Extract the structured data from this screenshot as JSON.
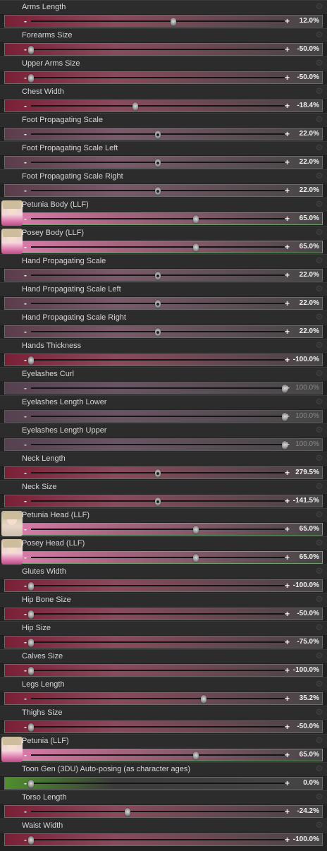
{
  "gear_icon": "gear-icon",
  "rows": [
    {
      "label": "Arms Length",
      "value": "12.0%",
      "pos": 0.56,
      "gradient": [
        "#7a1f36",
        "#8a4b5c"
      ],
      "muted": false,
      "thumb": false,
      "center": false
    },
    {
      "label": "Forearms Size",
      "value": "-50.0%",
      "pos": 0.0,
      "gradient": [
        "#7a1f36",
        "#8a4b5c"
      ],
      "muted": false,
      "thumb": false,
      "center": false
    },
    {
      "label": "Upper Arms Size",
      "value": "-50.0%",
      "pos": 0.0,
      "gradient": [
        "#7a1f36",
        "#8a4b5c"
      ],
      "muted": false,
      "thumb": false,
      "center": false
    },
    {
      "label": "Chest Width",
      "value": "-18.4%",
      "pos": 0.41,
      "gradient": [
        "#7a1f36",
        "#8a4b5c"
      ],
      "muted": false,
      "thumb": false,
      "center": false
    },
    {
      "label": "Foot Propagating Scale",
      "value": "22.0%",
      "pos": 0.5,
      "gradient": [
        "#5a3c4a",
        "#7a5a6a"
      ],
      "muted": false,
      "thumb": false,
      "center": true
    },
    {
      "label": "Foot Propagating Scale Left",
      "value": "22.0%",
      "pos": 0.5,
      "gradient": [
        "#5a3c4a",
        "#7a5a6a"
      ],
      "muted": false,
      "thumb": false,
      "center": true
    },
    {
      "label": "Foot Propagating Scale Right",
      "value": "22.0%",
      "pos": 0.5,
      "gradient": [
        "#5a3c4a",
        "#7a5a6a"
      ],
      "muted": false,
      "thumb": false,
      "center": true
    },
    {
      "label": "Petunia Body (LLF)",
      "value": "65.0%",
      "pos": 0.65,
      "gradient": [
        "#e07fb0",
        "#a6657f"
      ],
      "muted": false,
      "thumb": true,
      "center": false,
      "kind": "body"
    },
    {
      "label": "Posey Body (LLF)",
      "value": "65.0%",
      "pos": 0.65,
      "gradient": [
        "#e07fb0",
        "#a6657f"
      ],
      "muted": false,
      "thumb": true,
      "center": false,
      "kind": "body"
    },
    {
      "label": "Hand Propagating Scale",
      "value": "22.0%",
      "pos": 0.5,
      "gradient": [
        "#5a3c4a",
        "#7a5a6a"
      ],
      "muted": false,
      "thumb": false,
      "center": true
    },
    {
      "label": "Hand Propagating Scale Left",
      "value": "22.0%",
      "pos": 0.5,
      "gradient": [
        "#5a3c4a",
        "#7a5a6a"
      ],
      "muted": false,
      "thumb": false,
      "center": true
    },
    {
      "label": "Hand Propagating Scale Right",
      "value": "22.0%",
      "pos": 0.5,
      "gradient": [
        "#5a3c4a",
        "#7a5a6a"
      ],
      "muted": false,
      "thumb": false,
      "center": true
    },
    {
      "label": "Hands Thickness",
      "value": "-100.0%",
      "pos": 0.0,
      "gradient": [
        "#7a1f36",
        "#8a4b5c"
      ],
      "muted": false,
      "thumb": false,
      "center": false
    },
    {
      "label": "Eyelashes Curl",
      "value": "100.0%",
      "pos": 1.0,
      "gradient": [
        "#54404f",
        "#6b5565"
      ],
      "muted": true,
      "thumb": false,
      "center": false
    },
    {
      "label": "Eyelashes Length Lower",
      "value": "100.0%",
      "pos": 1.0,
      "gradient": [
        "#54404f",
        "#6b5565"
      ],
      "muted": true,
      "thumb": false,
      "center": false
    },
    {
      "label": "Eyelashes Length Upper",
      "value": "100.0%",
      "pos": 1.0,
      "gradient": [
        "#54404f",
        "#6b5565"
      ],
      "muted": true,
      "thumb": false,
      "center": false
    },
    {
      "label": "Neck Length",
      "value": "279.5%",
      "pos": 0.5,
      "gradient": [
        "#7a1f36",
        "#8a4b5c"
      ],
      "muted": false,
      "thumb": false,
      "center": true
    },
    {
      "label": "Neck Size",
      "value": "-141.5%",
      "pos": 0.5,
      "gradient": [
        "#7a1f36",
        "#8a4b5c"
      ],
      "muted": false,
      "thumb": false,
      "center": true
    },
    {
      "label": "Petunia Head (LLF)",
      "value": "65.0%",
      "pos": 0.65,
      "gradient": [
        "#e07fb0",
        "#a6657f"
      ],
      "muted": false,
      "thumb": true,
      "center": false,
      "kind": "head"
    },
    {
      "label": "Posey Head (LLF)",
      "value": "65.0%",
      "pos": 0.65,
      "gradient": [
        "#e07fb0",
        "#a6657f"
      ],
      "muted": false,
      "thumb": true,
      "center": false,
      "kind": "body"
    },
    {
      "label": "Glutes Width",
      "value": "-100.0%",
      "pos": 0.0,
      "gradient": [
        "#7a1f36",
        "#8a4b5c"
      ],
      "muted": false,
      "thumb": false,
      "center": false
    },
    {
      "label": "Hip Bone Size",
      "value": "-50.0%",
      "pos": 0.0,
      "gradient": [
        "#7a1f36",
        "#8a4b5c"
      ],
      "muted": false,
      "thumb": false,
      "center": false
    },
    {
      "label": "Hip Size",
      "value": "-75.0%",
      "pos": 0.0,
      "gradient": [
        "#7a1f36",
        "#8a4b5c"
      ],
      "muted": false,
      "thumb": false,
      "center": false
    },
    {
      "label": "Calves Size",
      "value": "-100.0%",
      "pos": 0.0,
      "gradient": [
        "#7a1f36",
        "#8a4b5c"
      ],
      "muted": false,
      "thumb": false,
      "center": false
    },
    {
      "label": "Legs Length",
      "value": "35.2%",
      "pos": 0.68,
      "gradient": [
        "#7a1f36",
        "#8a4b5c"
      ],
      "muted": false,
      "thumb": false,
      "center": false
    },
    {
      "label": "Thighs Size",
      "value": "-50.0%",
      "pos": 0.0,
      "gradient": [
        "#7a1f36",
        "#8a4b5c"
      ],
      "muted": false,
      "thumb": false,
      "center": false
    },
    {
      "label": "Petunia (LLF)",
      "value": "65.0%",
      "pos": 0.65,
      "gradient": [
        "#e07fb0",
        "#a6657f"
      ],
      "muted": false,
      "thumb": true,
      "center": false,
      "kind": "body"
    },
    {
      "label": "Toon Gen (3DU) Auto-posing (as character ages)",
      "value": "0.0%",
      "pos": 0.0,
      "gradient": [
        "#4e8f2e",
        "#3a3a3a"
      ],
      "muted": false,
      "thumb": false,
      "center": false
    },
    {
      "label": "Torso Length",
      "value": "-24.2%",
      "pos": 0.38,
      "gradient": [
        "#7a1f36",
        "#8a4b5c"
      ],
      "muted": false,
      "thumb": false,
      "center": false
    },
    {
      "label": "Waist Width",
      "value": "-100.0%",
      "pos": 0.0,
      "gradient": [
        "#7a1f36",
        "#8a4b5c"
      ],
      "muted": false,
      "thumb": false,
      "center": false
    }
  ]
}
